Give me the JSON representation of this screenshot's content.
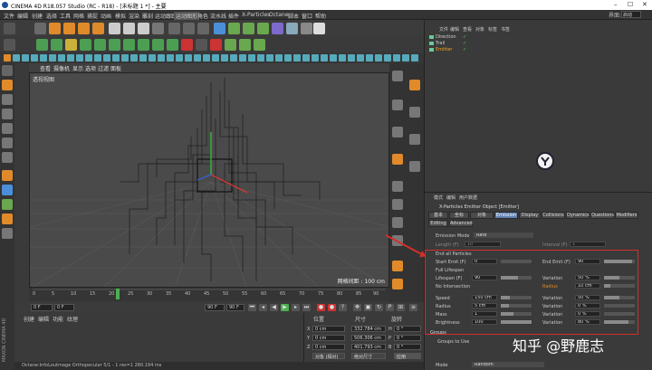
{
  "window": {
    "title": "CINEMA 4D R18.057 Studio (RC - R18) - [未标题 1 *] - 主要",
    "controls": [
      "–",
      "☐",
      "✕"
    ]
  },
  "menubar": {
    "items": [
      "文件",
      "编辑",
      "创建",
      "选择",
      "工具",
      "网格",
      "捕捉",
      "动画",
      "模拟",
      "渲染",
      "雕刻",
      "运动跟踪",
      "运动图形",
      "角色",
      "流水线",
      "插件",
      "X-Particles",
      "Octane",
      "脚本",
      "窗口",
      "帮助"
    ],
    "highlighted": "运动图形",
    "layout_label": "界面:",
    "layout_value": "启动"
  },
  "viewport": {
    "menu": [
      "查看",
      "摄像机",
      "显示",
      "选项",
      "过滤",
      "面板"
    ],
    "camera_label": "透视视图",
    "grid_spacing": "网格间距 : 100 cm"
  },
  "timeline": {
    "ticks": [
      "0",
      "5",
      "10",
      "15",
      "20",
      "25",
      "30",
      "35",
      "40",
      "45",
      "50",
      "55",
      "60",
      "65",
      "70",
      "75",
      "80",
      "85",
      "90"
    ],
    "end_label": "0 F"
  },
  "transport": {
    "start": "0 F",
    "current": "0 F",
    "end": "90 F",
    "end2": "90 F"
  },
  "material": {
    "menu": [
      "创建",
      "编辑",
      "功能",
      "纹理"
    ]
  },
  "coordinates": {
    "headers": [
      "位置",
      "尺寸",
      "旋转"
    ],
    "rows": [
      {
        "axis": "X",
        "pos": "0 cm",
        "size": "332.784 cm",
        "rot_label": "H",
        "rot": "0 °"
      },
      {
        "axis": "Y",
        "pos": "0 cm",
        "size": "506.306 cm",
        "rot_label": "P",
        "rot": "0 °"
      },
      {
        "axis": "Z",
        "pos": "0 cm",
        "size": "401.793 cm",
        "rot_label": "B",
        "rot": "0 °"
      }
    ],
    "mode": "对象 (相对)",
    "size_mode": "绝对尺寸",
    "apply": "应用"
  },
  "status": "Octane:InfoLoutmage Orthopecular  5/1 - 1 res=1  280.194 ms",
  "maxon": "MAXON CINEMA 4D",
  "object_manager": {
    "menu": [
      "文件",
      "编辑",
      "查看",
      "对象",
      "标签",
      "书签"
    ],
    "objects": [
      {
        "name": "Direction",
        "selected": false
      },
      {
        "name": "Trail",
        "selected": false
      },
      {
        "name": "Emitter",
        "selected": true
      }
    ]
  },
  "attributes": {
    "menu": [
      "模式",
      "编辑",
      "用户数据"
    ],
    "title": "X-Particles Emitter Object [Emitter]",
    "tabs_row1": [
      "基本",
      "坐标",
      "对象",
      "Emission",
      "Display",
      "Collisions",
      "Dynamics",
      "Questions",
      "Modifiers"
    ],
    "tabs_row2": [
      "Editing",
      "Advanced"
    ],
    "active_tab": "Emission",
    "emission_mode_label": "Emission Mode",
    "emission_mode_value": "Rate",
    "length_label": "Length (F)",
    "length_value": "10",
    "interval_label": "Interval (F)",
    "interval_value": "1",
    "end_all": "End all Particles",
    "start_label": "Start Emit (F)",
    "start_value": "0",
    "end_label": "End Emit (F)",
    "end_value": "90",
    "full_lifespan": "Full Lifespan",
    "lifespan_label": "Lifespan (F)",
    "lifespan_value": "90",
    "variation_label": "Variation",
    "lifespan_var": "50 %",
    "no_intersection": "No Intersection",
    "radius_label": "Radius",
    "radius_value": "10 cm",
    "speed_label": "Speed",
    "speed_value": "150 cm",
    "speed_var": "50 %",
    "radius2_label": "Radius",
    "radius2_value": "5 cm",
    "radius2_var": "0 %",
    "mass_label": "Mass",
    "mass_value": "1",
    "mass_var": "0 %",
    "brightness_label": "Brightness",
    "brightness_value": "100",
    "brightness_var": "80 %",
    "groups_label": "Groups",
    "groups_to_use": "Groups to Use",
    "mode_label": "Mode",
    "mode_value": "Random",
    "speed_bar": 0.3,
    "radius2_bar": 0.25,
    "mass_bar": 0.4,
    "brightness_bar": 1.0,
    "lifespan_bar": 0.55,
    "end_bar": 0.9
  },
  "watermark": "知乎 @野鹿志",
  "colors": {
    "accent_tab": "#607fb0",
    "highlight_box": "#d2302a",
    "selected_object": "#f5a623"
  }
}
